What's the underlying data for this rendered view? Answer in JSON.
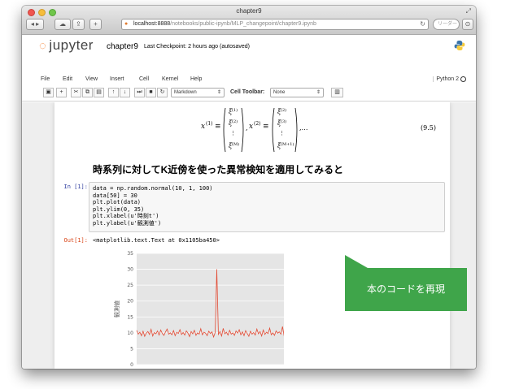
{
  "window": {
    "title": "chapter9"
  },
  "browser": {
    "url_host": "localhost:8888",
    "url_path": "/notebooks/public-ipynb/MLP_changepoint/chapter9.ipynb",
    "search_placeholder": "リーダー"
  },
  "header": {
    "logo_text": "jupyter",
    "notebook_name": "chapter9",
    "checkpoint": "Last Checkpoint: 2 hours ago (autosaved)"
  },
  "menu": {
    "items": [
      "File",
      "Edit",
      "View",
      "Insert",
      "Cell",
      "Kernel",
      "Help"
    ],
    "kernel": "Python 2"
  },
  "toolbar": {
    "cell_type": "Markdown",
    "cell_toolbar_label": "Cell Toolbar:",
    "cell_toolbar_value": "None"
  },
  "notebook": {
    "equation_number": "(9.5)",
    "heading": "時系列に対してK近傍を使った異常検知を適用してみると",
    "in_prompt": "In [1]:",
    "code_lines": [
      "data = np.random.normal(10, 1, 100)",
      "data[50] = 30",
      "plt.plot(data)",
      "plt.ylim(0, 35)",
      "plt.xlabel(u'時刻t')",
      "plt.ylabel(u'観測値')"
    ],
    "out_prompt": "Out[1]:",
    "out_text": "<matplotlib.text.Text at 0x1105ba450>"
  },
  "callout": {
    "text": "本のコードを再現"
  },
  "chart_data": {
    "type": "line",
    "ylabel": "観測値",
    "ylim": [
      0,
      35
    ],
    "xlim": [
      0,
      100
    ],
    "yticks": [
      0,
      5,
      10,
      15,
      20,
      25,
      30,
      35
    ],
    "grid": true,
    "color": "#e24a33",
    "background": "#e5e5e5",
    "series": [
      {
        "values": [
          10.8,
          9.6,
          10.2,
          9.1,
          10.5,
          8.9,
          9.9,
          10.4,
          9.5,
          11.1,
          9.0,
          10.1,
          9.7,
          10.6,
          9.3,
          10.9,
          9.8,
          9.2,
          10.3,
          11.2,
          9.6,
          10.0,
          9.4,
          10.7,
          9.1,
          10.2,
          9.8,
          11.0,
          9.5,
          10.1,
          9.3,
          10.6,
          9.9,
          8.8,
          10.4,
          9.7,
          10.8,
          9.2,
          10.0,
          9.6,
          11.3,
          9.4,
          10.2,
          9.9,
          9.1,
          10.5,
          9.8,
          10.3,
          8.7,
          10.1,
          30,
          9.5,
          10.4,
          9.0,
          11.4,
          9.7,
          10.2,
          9.3,
          10.8,
          9.6,
          10.0,
          9.2,
          10.6,
          9.9,
          11.0,
          9.4,
          10.3,
          9.1,
          10.7,
          9.8,
          8.9,
          10.5,
          9.6,
          10.1,
          9.3,
          11.2,
          9.7,
          10.4,
          9.0,
          10.9,
          9.5,
          10.2,
          9.8,
          11.5,
          9.4,
          10.0,
          9.2,
          10.6,
          9.9,
          10.3,
          9.6,
          12.0,
          9.1,
          10.4,
          9.7,
          10.8,
          9.3,
          10.1,
          9.9,
          10.2
        ]
      }
    ]
  }
}
